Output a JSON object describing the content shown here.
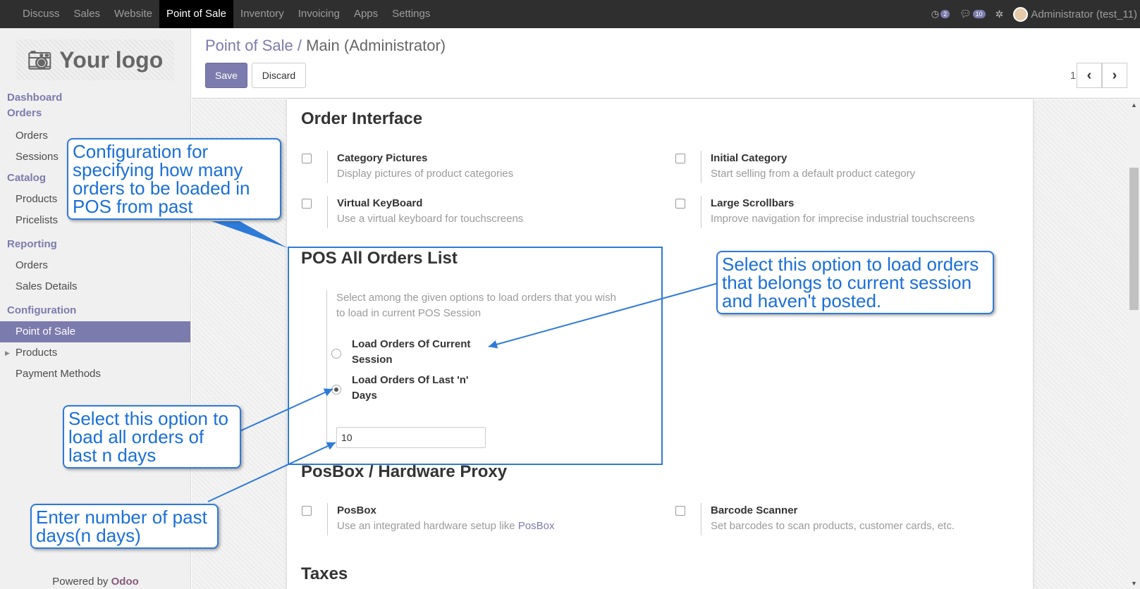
{
  "navbar": {
    "apps": [
      "Discuss",
      "Sales",
      "Website",
      "Point of Sale",
      "Inventory",
      "Invoicing",
      "Apps",
      "Settings"
    ],
    "active_app": "Point of Sale",
    "activity_badge": "2",
    "messages_badge": "10",
    "user": "Administrator (test_11)"
  },
  "sidebar": {
    "logo": "Your logo",
    "dashboard": "Dashboard",
    "orders_head": "Orders",
    "orders_items": [
      "Orders",
      "Sessions"
    ],
    "catalog_head": "Catalog",
    "catalog_items": [
      "Products",
      "Pricelists"
    ],
    "reporting_head": "Reporting",
    "reporting_items": [
      "Orders",
      "Sales Details"
    ],
    "config_head": "Configuration",
    "config_items": [
      "Point of Sale",
      "Products",
      "Payment Methods"
    ],
    "powered_prefix": "Powered by ",
    "powered_brand": "Odoo"
  },
  "control_panel": {
    "breadcrumb_parent": "Point of Sale",
    "breadcrumb_sep": " / ",
    "breadcrumb_current": "Main (Administrator)",
    "save_label": "Save",
    "discard_label": "Discard",
    "pager": "1 / 2"
  },
  "form": {
    "order_interface": {
      "title": "Order Interface",
      "settings": [
        {
          "title": "Category Pictures",
          "desc": "Display pictures of product categories"
        },
        {
          "title": "Initial Category",
          "desc": "Start selling from a default product category"
        },
        {
          "title": "Virtual KeyBoard",
          "desc": "Use a virtual keyboard for touchscreens"
        },
        {
          "title": "Large Scrollbars",
          "desc": "Improve navigation for imprecise industrial touchscreens"
        }
      ]
    },
    "pos_orders": {
      "title": "POS All Orders List",
      "desc_line1": "Select among the given options to load orders that you wish",
      "desc_line2": "to load in current POS Session",
      "option1": "Load Orders Of Current Session",
      "option2": "Load Orders Of Last 'n' Days",
      "selected": "option2",
      "days_value": "10"
    },
    "posbox": {
      "title": "PosBox / Hardware Proxy",
      "posbox_title": "PosBox",
      "posbox_desc": "Use an integrated hardware setup like ",
      "posbox_link": "PosBox",
      "barcode_title": "Barcode Scanner",
      "barcode_desc": "Set barcodes to scan products, customer cards, etc."
    },
    "taxes_title": "Taxes"
  },
  "callouts": {
    "config": "Configuration for specifying how many orders to be loaded in POS from past",
    "current_session": "Select this option to load orders that belongs to current session and haven't posted.",
    "last_n_days": "Select this option to load all orders of last n days",
    "enter_days": "Enter number of past days(n days)"
  },
  "colors": {
    "accent": "#7c7bad",
    "callout": "#2e7ad8",
    "navbar": "#2f2f2f"
  }
}
